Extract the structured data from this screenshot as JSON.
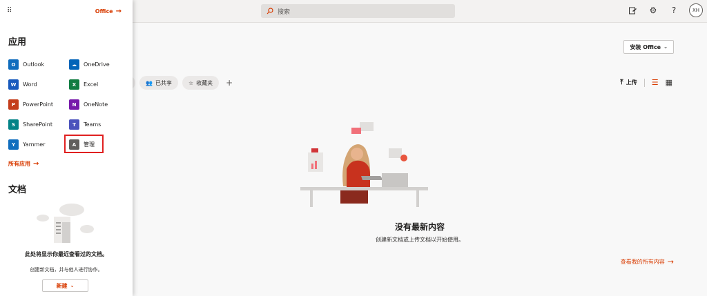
{
  "search": {
    "placeholder": "搜索"
  },
  "topbar": {
    "avatar_initials": "XH"
  },
  "main": {
    "install_label": "安装 Office",
    "chips": [
      "已共享",
      "收藏夹"
    ],
    "upload_label": "上传",
    "empty_title": "没有最新内容",
    "empty_subtitle": "创建新文档或上传文档以开始使用。",
    "view_all_label": "查看我的所有内容"
  },
  "panel": {
    "office_link": "Office",
    "apps_title": "应用",
    "apps": [
      {
        "label": "Outlook",
        "icon": "outlook-icon",
        "color": "#0f6cbd",
        "glyph": "O"
      },
      {
        "label": "OneDrive",
        "icon": "onedrive-icon",
        "color": "#0364b8",
        "glyph": "☁"
      },
      {
        "label": "Word",
        "icon": "word-icon",
        "color": "#185abd",
        "glyph": "W"
      },
      {
        "label": "Excel",
        "icon": "excel-icon",
        "color": "#107c41",
        "glyph": "X"
      },
      {
        "label": "PowerPoint",
        "icon": "powerpoint-icon",
        "color": "#c43e1c",
        "glyph": "P"
      },
      {
        "label": "OneNote",
        "icon": "onenote-icon",
        "color": "#7719aa",
        "glyph": "N"
      },
      {
        "label": "SharePoint",
        "icon": "sharepoint-icon",
        "color": "#038387",
        "glyph": "S"
      },
      {
        "label": "Teams",
        "icon": "teams-icon",
        "color": "#4b53bc",
        "glyph": "T"
      },
      {
        "label": "Yammer",
        "icon": "yammer-icon",
        "color": "#106ebe",
        "glyph": "Y"
      },
      {
        "label": "管理",
        "icon": "admin-icon",
        "color": "#605e5c",
        "glyph": "A"
      }
    ],
    "all_apps_label": "所有应用",
    "docs_title": "文档",
    "docs_empty_title": "此处将显示你最近查看过的文档。",
    "docs_empty_subtitle": "创建新文档，并与他人进行协作。",
    "new_label": "新建"
  },
  "colors": {
    "accent": "#d83b01",
    "highlight": "#e02020"
  }
}
